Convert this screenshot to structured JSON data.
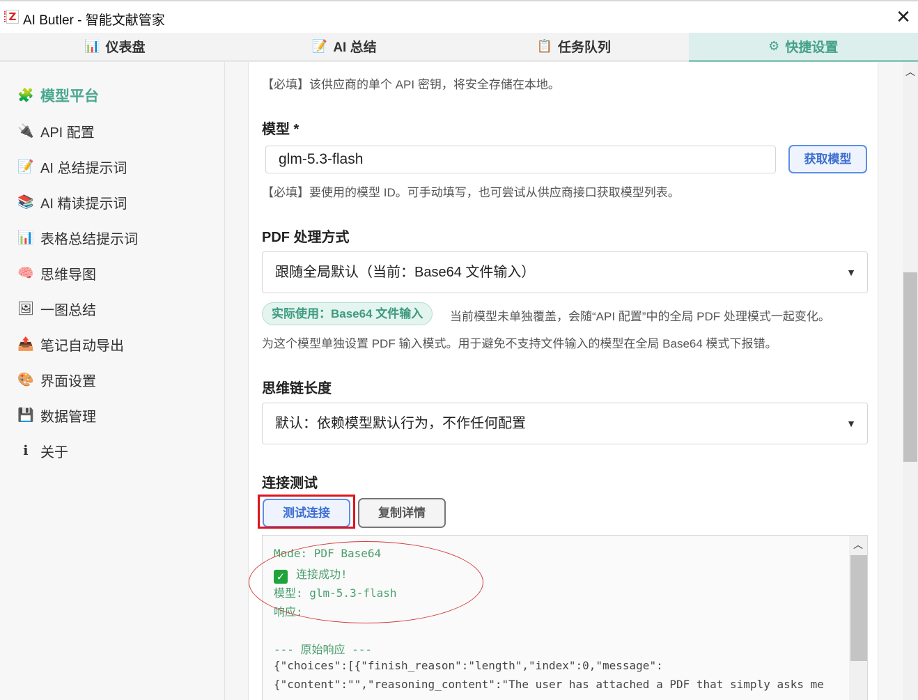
{
  "window": {
    "title": "AI Butler - 智能文献管家",
    "close_symbol": "✕"
  },
  "tabs": [
    {
      "label": "仪表盘",
      "icon": "📊"
    },
    {
      "label": "AI 总结",
      "icon": "📝"
    },
    {
      "label": "任务队列",
      "icon": "📋"
    },
    {
      "label": "快捷设置",
      "icon": "⚙"
    }
  ],
  "sidebar": {
    "items": [
      {
        "label": "模型平台",
        "icon": "🧩"
      },
      {
        "label": "API 配置",
        "icon": "🔌"
      },
      {
        "label": "AI 总结提示词",
        "icon": "📝"
      },
      {
        "label": "AI 精读提示词",
        "icon": "📚"
      },
      {
        "label": "表格总结提示词",
        "icon": "📊"
      },
      {
        "label": "思维导图",
        "icon": "🧠"
      },
      {
        "label": "一图总结",
        "icon": "🖼"
      },
      {
        "label": "笔记自动导出",
        "icon": "📤"
      },
      {
        "label": "界面设置",
        "icon": "🎨"
      },
      {
        "label": "数据管理",
        "icon": "💾"
      },
      {
        "label": "关于",
        "icon": "ℹ"
      }
    ]
  },
  "api_key": {
    "hint": "【必填】该供应商的单个 API 密钥，将安全存储在本地。"
  },
  "model": {
    "label": "模型 *",
    "value": "glm-5.3-flash",
    "fetch_button": "获取模型",
    "hint": "【必填】要使用的模型 ID。可手动填写，也可尝试从供应商接口获取模型列表。"
  },
  "pdf": {
    "label": "PDF 处理方式",
    "selected": "跟随全局默认（当前：Base64 文件输入）",
    "badge": "实际使用：Base64 文件输入",
    "badge_desc": "当前模型未单独覆盖，会随“API 配置”中的全局 PDF 处理模式一起变化。",
    "hint": "为这个模型单独设置 PDF 输入模式。用于避免不支持文件输入的模型在全局 Base64 模式下报错。"
  },
  "reasoning": {
    "label": "思维链长度",
    "selected": "默认：依赖模型默认行为，不作任何配置"
  },
  "connection_test": {
    "label": "连接测试",
    "test_button": "测试连接",
    "copy_button": "复制详情",
    "log": {
      "line1": "Mode: PDF Base64",
      "line2": "连接成功!",
      "line3": "模型: glm-5.3-flash",
      "line4": "响应:",
      "line5": "--- 原始响应 ---",
      "line6": "{\"choices\":[{\"finish_reason\":\"length\",\"index\":0,\"message\":",
      "line7": "{\"content\":\"\",\"reasoning_content\":\"The user has attached a PDF that simply asks me"
    }
  },
  "colors": {
    "accent": "#4aa88f",
    "button_blue": "#5b8fe6",
    "highlight_red": "#e0141e",
    "log_green": "#4a9e6c"
  }
}
